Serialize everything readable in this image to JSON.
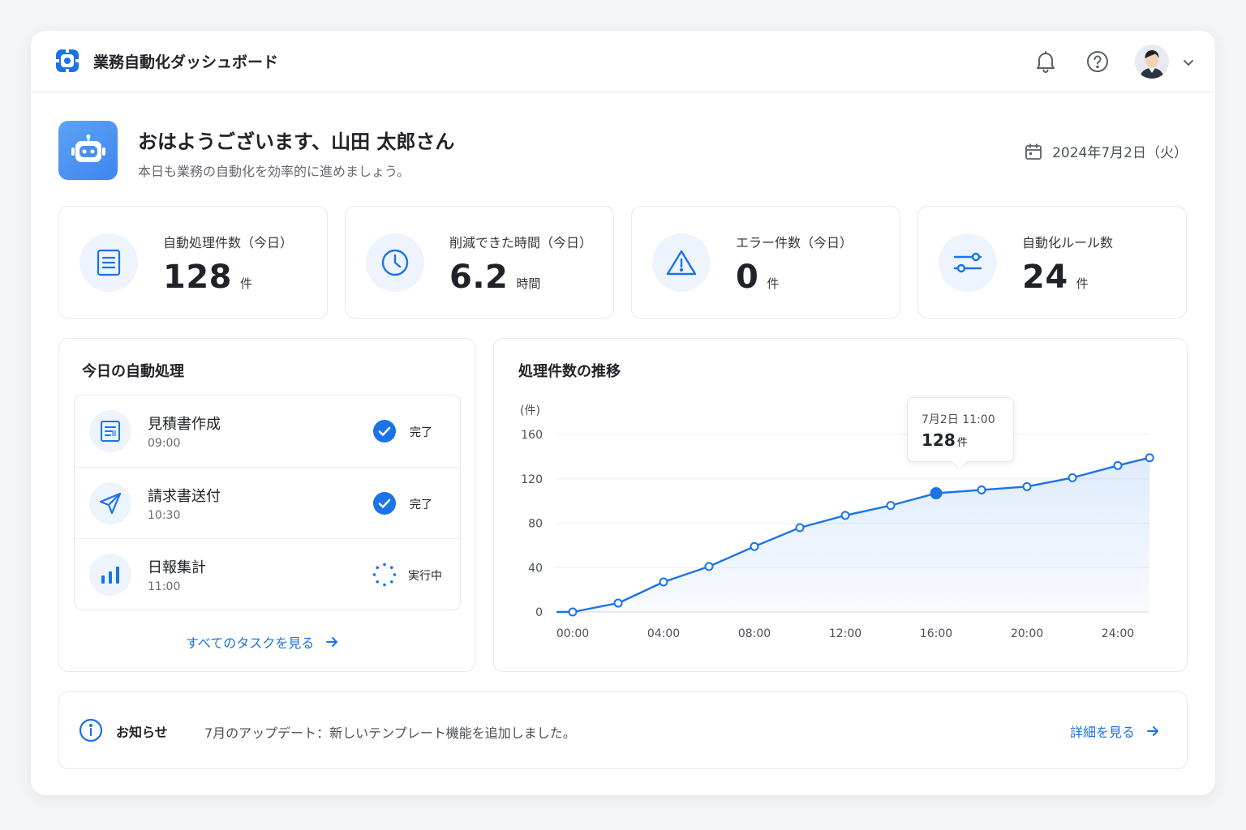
{
  "header": {
    "app_title": "業務自動化ダッシュボード",
    "icons": [
      "logo-icon",
      "bell-icon",
      "help-icon",
      "avatar",
      "chevron-down-icon"
    ]
  },
  "greeting": {
    "title": "おはようございます、山田 太郎さん",
    "subtitle": "本日も業務の自動化を効率的に進めましょう。",
    "date": "2024年7月2日（火）"
  },
  "stats": [
    {
      "label": "自動処理件数（今日）",
      "value": "128",
      "unit": "件",
      "icon": "document-icon"
    },
    {
      "label": "削減できた時間（今日）",
      "value": "6.2",
      "unit": "時間",
      "icon": "clock-icon"
    },
    {
      "label": "エラー件数（今日）",
      "value": "0",
      "unit": "件",
      "icon": "warning-icon"
    },
    {
      "label": "自動化ルール数",
      "value": "24",
      "unit": "件",
      "icon": "sliders-icon"
    }
  ],
  "tasks_panel": {
    "title": "今日の自動処理",
    "items": [
      {
        "name": "見積書作成",
        "time": "09:00",
        "status": "完了",
        "icon": "quote-document-icon"
      },
      {
        "name": "請求書送付",
        "time": "10:30",
        "status": "完了",
        "icon": "send-icon"
      },
      {
        "name": "日報集計",
        "time": "11:00",
        "status": "実行中",
        "icon": "bar-chart-icon"
      }
    ],
    "view_all": "すべてのタスクを見る"
  },
  "chart_panel": {
    "title": "処理件数の推移",
    "tooltip": {
      "time": "7月2日 11:00",
      "value": "128",
      "unit": "件"
    }
  },
  "chart_data": {
    "type": "line",
    "ylabel": "(件)",
    "ylim": [
      0,
      160
    ],
    "yticks": [
      0,
      40,
      80,
      120,
      160
    ],
    "xlim": [
      0,
      24
    ],
    "xticks": [
      "00:00",
      "04:00",
      "08:00",
      "12:00",
      "16:00",
      "20:00",
      "24:00"
    ],
    "x": [
      0,
      2,
      4,
      6,
      8,
      10,
      12,
      14,
      16,
      18,
      20,
      22,
      24,
      25.4
    ],
    "values": [
      0,
      8,
      27,
      41,
      59,
      76,
      87,
      96,
      107,
      110,
      113,
      121,
      132,
      139
    ],
    "highlight_index": 8,
    "area_fill": true,
    "grid": true,
    "accent_color": "#1a73e8"
  },
  "notice": {
    "label": "お知らせ",
    "text": "7月のアップデート：新しいテンプレート機能を追加しました。",
    "link": "詳細を見る"
  },
  "colors": {
    "accent": "#1a73e8",
    "icon_bg": "#eef4fd",
    "border": "#e6e8ec"
  }
}
